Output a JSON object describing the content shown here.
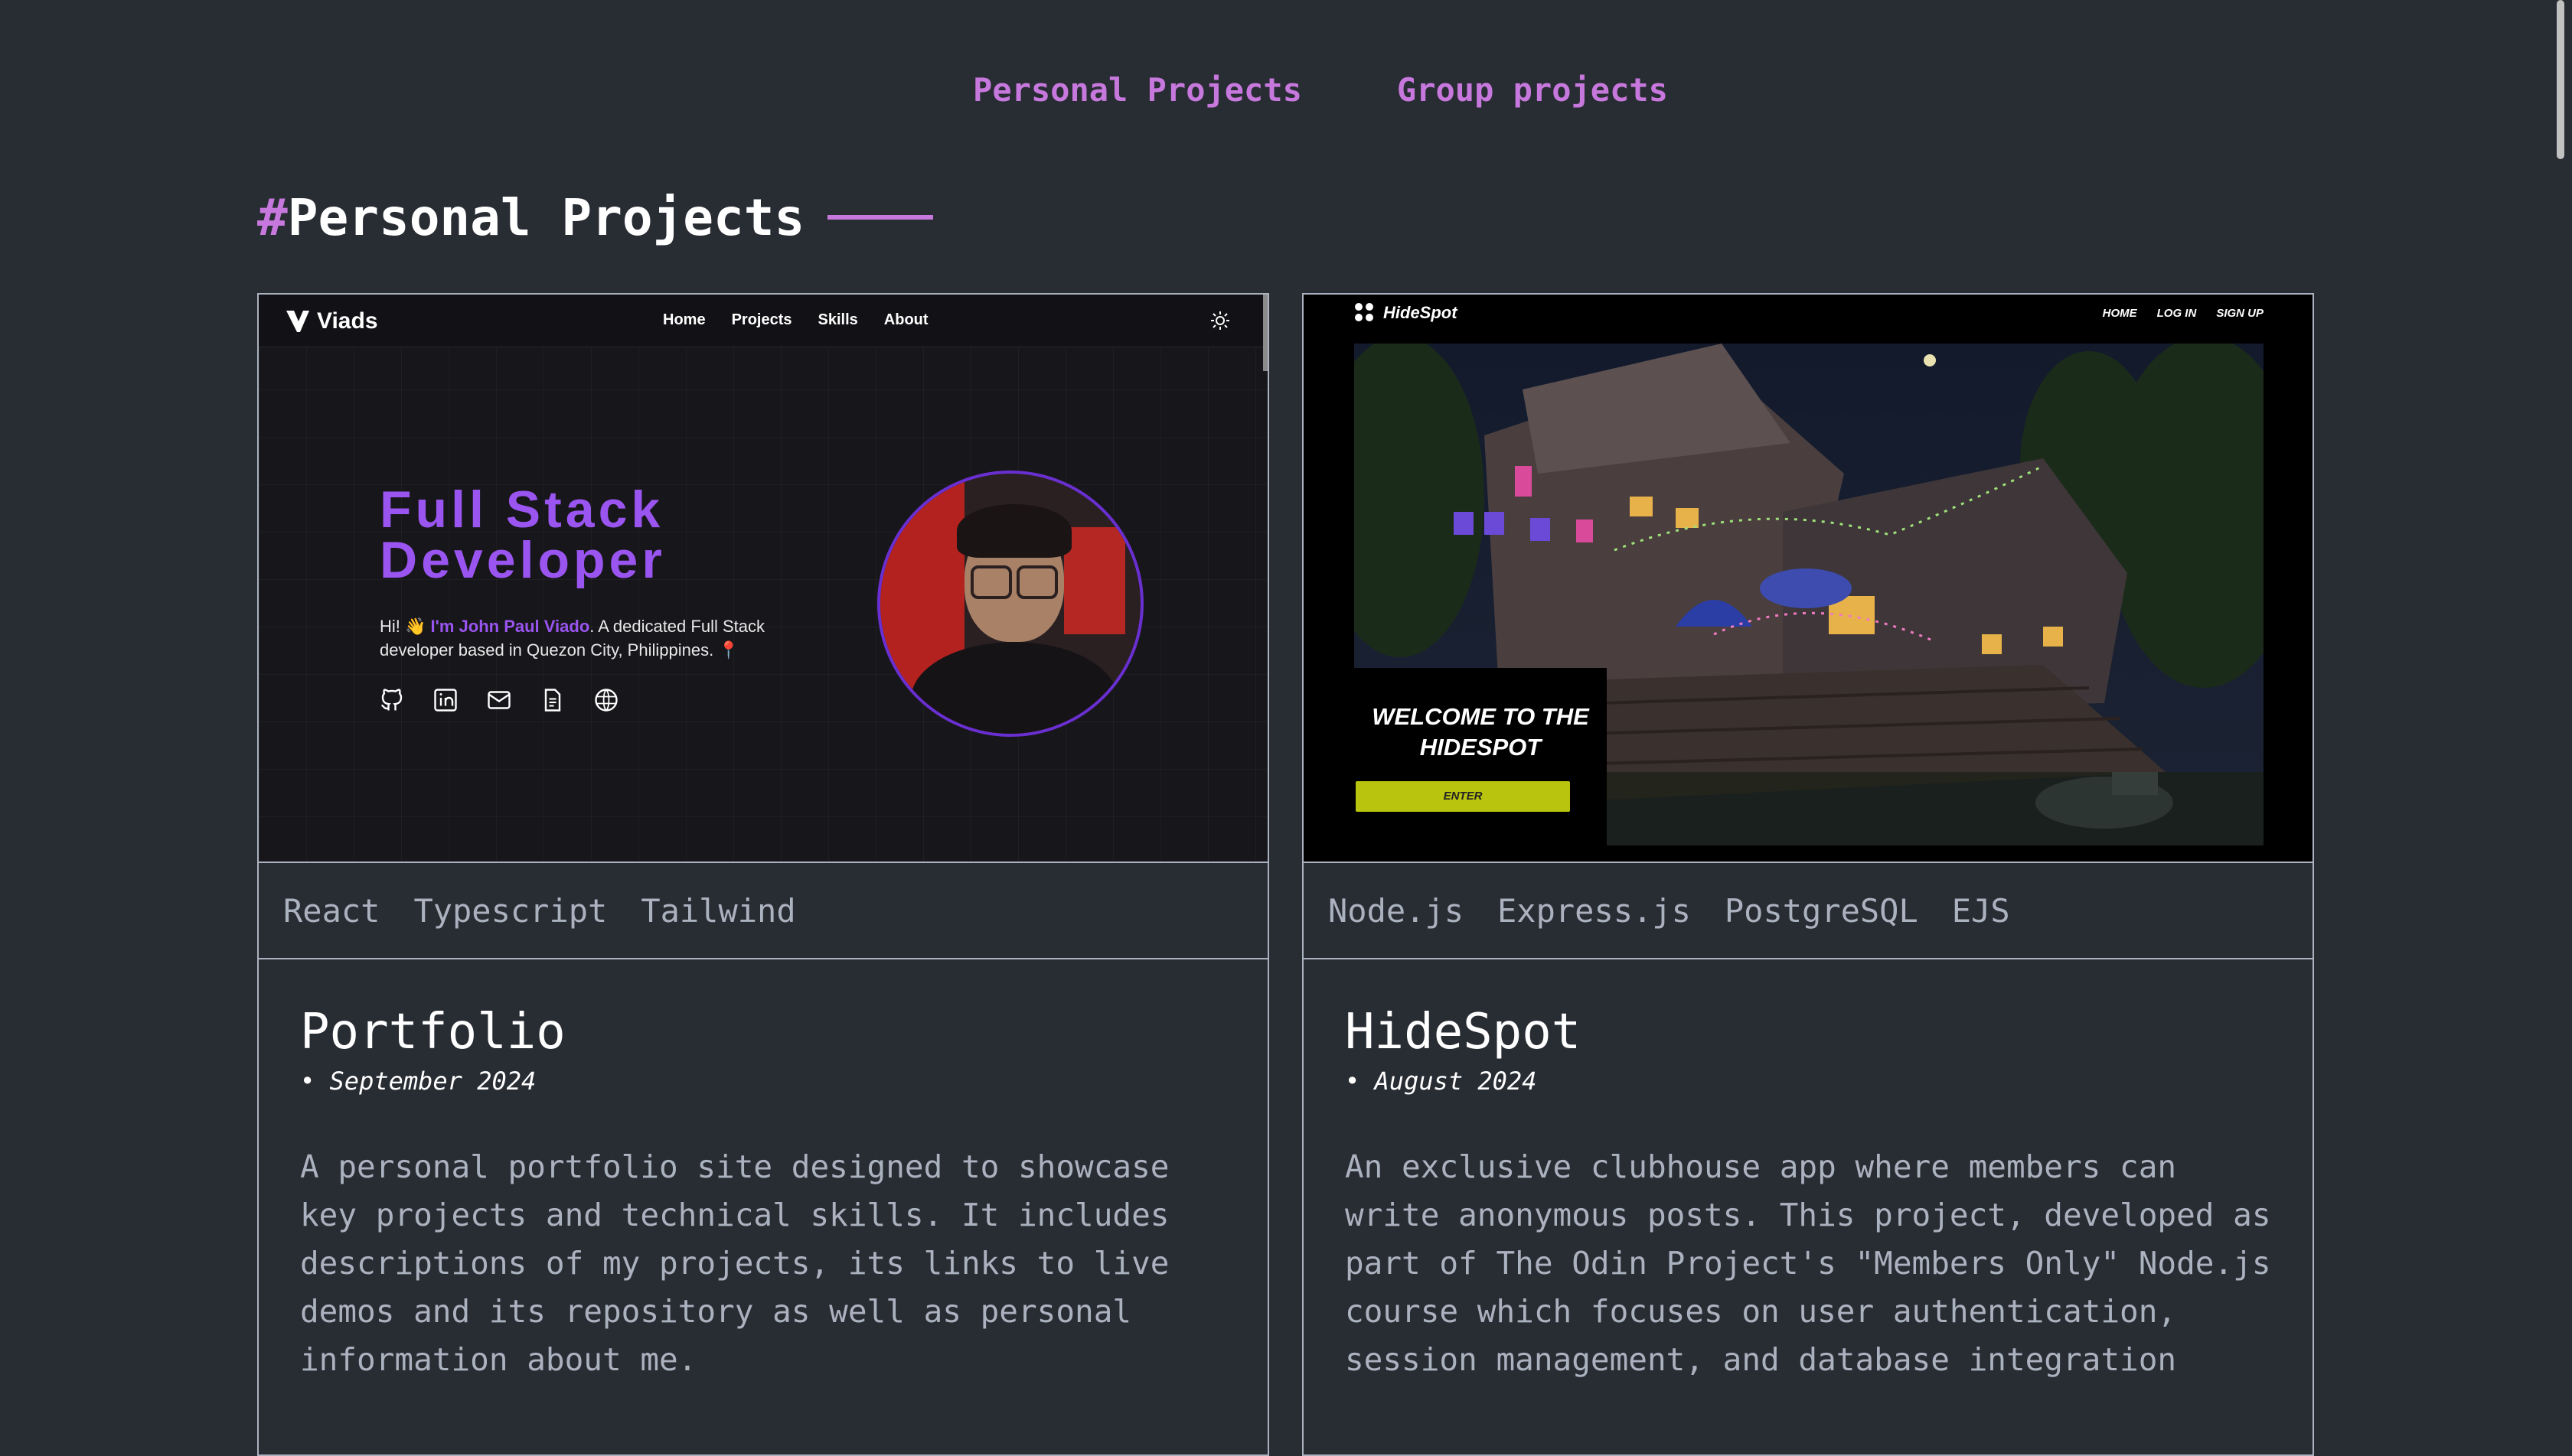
{
  "nav": {
    "tabs": [
      {
        "label": "Personal Projects"
      },
      {
        "label": "Group projects"
      }
    ]
  },
  "section": {
    "hash": "#",
    "title": "Personal Projects"
  },
  "projects": [
    {
      "tech": [
        "React",
        "Typescript",
        "Tailwind"
      ],
      "title": "Portfolio",
      "date": "• September 2024",
      "description": "A personal portfolio site designed to showcase key projects and technical skills. It includes descriptions of my projects, its links to live demos and its repository as well as personal information about me.",
      "preview": {
        "logo": "Viads",
        "links": [
          "Home",
          "Projects",
          "Skills",
          "About"
        ],
        "headline_1": "Full Stack",
        "headline_2": "Developer",
        "intro_prefix": "Hi! 👋 ",
        "intro_name": "I'm John Paul Viado",
        "intro_suffix": ". A dedicated Full Stack developer based in Quezon City, Philippines. 📍",
        "icons": [
          "github-icon",
          "linkedin-icon",
          "mail-icon",
          "document-icon",
          "globe-icon"
        ]
      }
    },
    {
      "tech": [
        "Node.js",
        "Express.js",
        "PostgreSQL",
        "EJS"
      ],
      "title": "HideSpot",
      "date": "• August 2024",
      "description": "An exclusive clubhouse app where members can write anonymous posts. This project, developed as part of The Odin Project's \"Members Only\" Node.js course which focuses on user authentication, session management, and database integration",
      "preview": {
        "logo": "HideSpot",
        "links": [
          "HOME",
          "LOG IN",
          "SIGN UP"
        ],
        "welcome": "WELCOME TO THE HIDESPOT",
        "enter": "ENTER"
      }
    }
  ],
  "colors": {
    "background": "#282c33",
    "accent": "#c778dd",
    "text_muted": "#abb2bf",
    "viads_purple": "#9a55f0",
    "hidespot_button": "#b8c40d"
  }
}
